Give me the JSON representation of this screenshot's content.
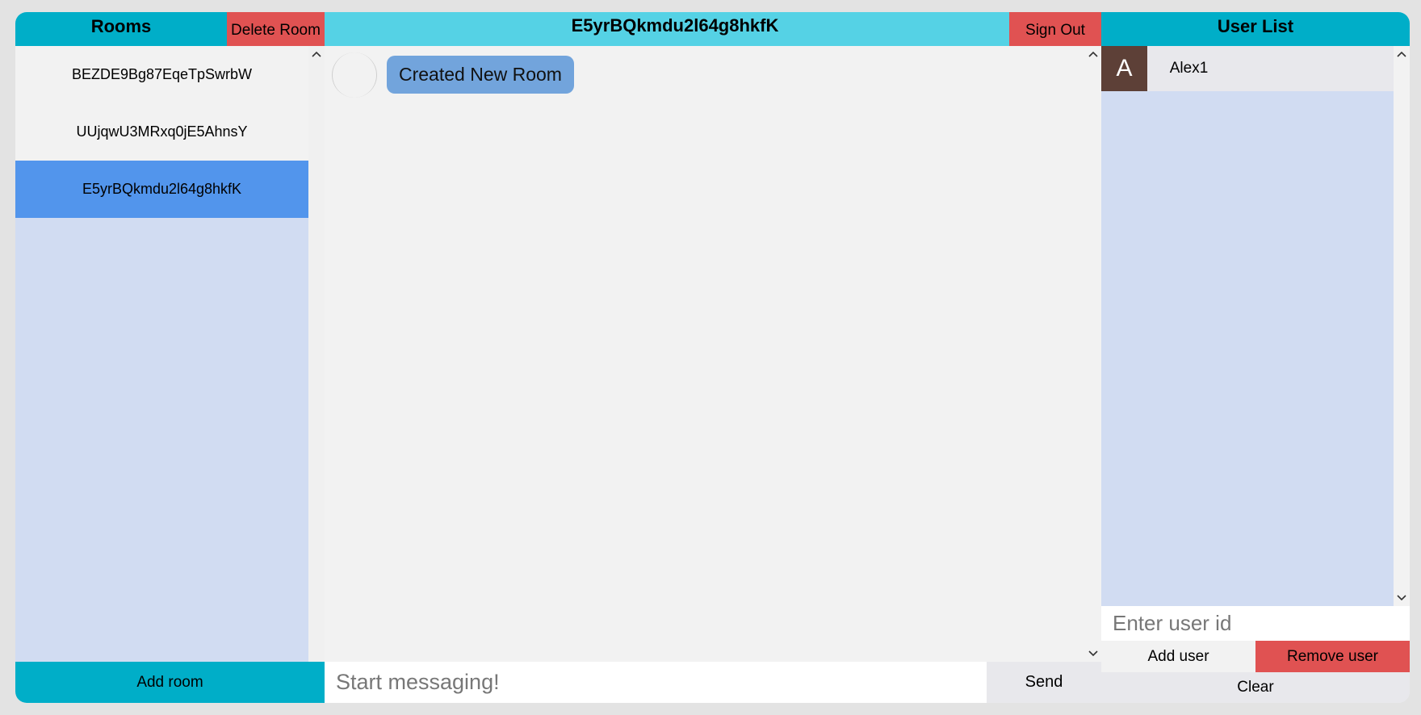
{
  "rooms": {
    "title": "Rooms",
    "delete_label": "Delete Room",
    "items": [
      {
        "label": "BEZDE9Bg87EqeTpSwrbW"
      },
      {
        "label": "UUjqwU3MRxq0jE5AhnsY"
      },
      {
        "label": "E5yrBQkmdu2l64g8hkfK",
        "selected": true
      }
    ],
    "add_label": "Add room"
  },
  "chat": {
    "title": "E5yrBQkmdu2l64g8hkfK",
    "sign_out_label": "Sign Out",
    "messages": [
      {
        "text": "Created New Room"
      }
    ],
    "input_placeholder": "Start messaging!",
    "send_label": "Send"
  },
  "users": {
    "title": "User List",
    "items": [
      {
        "initial": "A",
        "name": "Alex1"
      }
    ],
    "input_placeholder": "Enter user id",
    "add_label": "Add user",
    "remove_label": "Remove user",
    "clear_label": "Clear"
  },
  "colors": {
    "header_accent": "#00aec8",
    "chat_header": "#55d2e5",
    "danger": "#e05252",
    "selected_room": "#5295ec",
    "list_background": "#d1dcf2",
    "message_bubble": "#72a4dc",
    "user_avatar": "#5d4037"
  },
  "icons": {
    "scroll_up": "chevron-up-icon",
    "scroll_down": "chevron-down-icon"
  }
}
